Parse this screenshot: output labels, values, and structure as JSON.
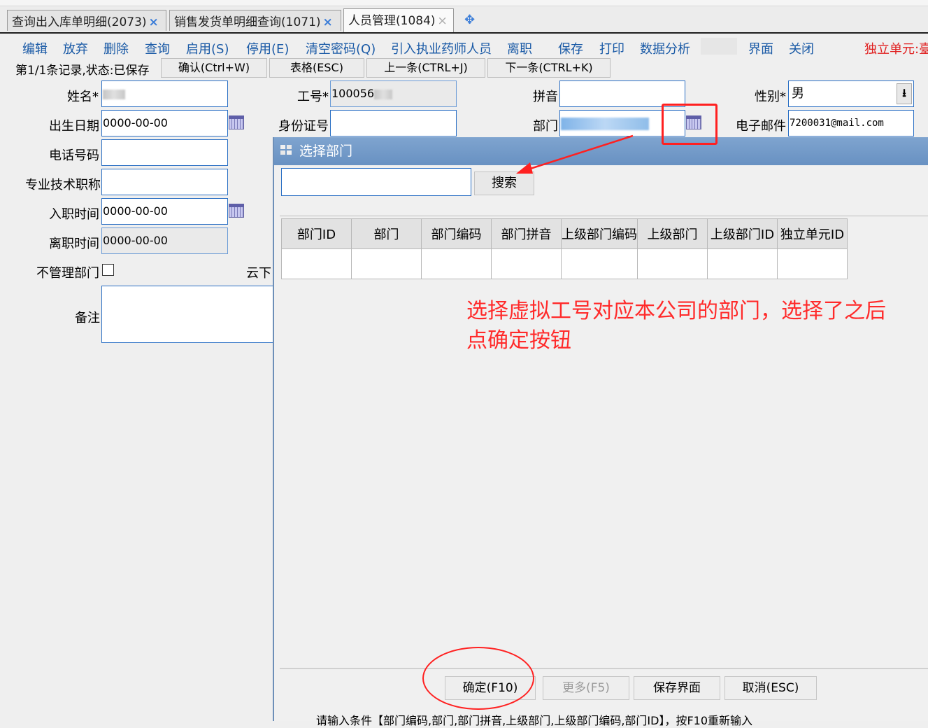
{
  "tabs": [
    {
      "label": "查询出入库单明细(2073)",
      "close": "×"
    },
    {
      "label": "销售发货单明细查询(1071)",
      "close": "×"
    },
    {
      "label": "人员管理(1084)",
      "close": "×"
    }
  ],
  "tab_add": "✥",
  "menu": [
    "编辑",
    "放弃",
    "删除",
    "查询",
    "启用(S)",
    "停用(E)",
    "清空密码(Q)",
    "引入执业药师人员",
    "离职",
    "保存",
    "打印",
    "数据分析",
    "界面",
    "关闭"
  ],
  "unit_label": "独立单元:臺",
  "record_status": "第1/1条记录,状态:已保存",
  "nav": {
    "confirm": "确认(Ctrl+W)",
    "grid": "表格(ESC)",
    "prev": "上一条(CTRL+J)",
    "next": "下一条(CTRL+K)"
  },
  "form": {
    "name_label": "姓名*",
    "name_value": "",
    "empno_label": "工号*",
    "empno_value": "100056",
    "pinyin_label": "拼音",
    "gender_label": "性别*",
    "gender_value": "男",
    "birth_label": "出生日期",
    "birth_value": "0000-00-00",
    "idcard_label": "身份证号",
    "dept_label": "部门",
    "email_label": "电子邮件",
    "email_value": "7200031@mail.com",
    "phone_label": "电话号码",
    "title_label": "专业技术职称",
    "join_label": "入职时间",
    "join_value": "0000-00-00",
    "leave_label": "离职时间",
    "leave_value": "0000-00-00",
    "nomanage_label": "不管理部门",
    "cloud_label": "云下",
    "remark_label": "备注"
  },
  "dialog": {
    "title": "选择部门",
    "search_button": "搜索",
    "columns": [
      "部门ID",
      "部门",
      "部门编码",
      "部门拼音",
      "上级部门编码",
      "上级部门",
      "上级部门ID",
      "独立单元ID"
    ],
    "note_line1": "选择虚拟工号对应本公司的部门，选择了之后",
    "note_line2": "点确定按钮",
    "buttons": {
      "ok": "确定(F10)",
      "more": "更多(F5)",
      "save_layout": "保存界面",
      "cancel": "取消(ESC)"
    },
    "hint": "请输入条件【部门编码,部门,部门拼音,上级部门,上级部门编码,部门ID】，按F10重新输入"
  },
  "colors": {
    "accent": "#1a5aa6",
    "annotation": "#ff2020",
    "dialog_title": "#6f97c6"
  }
}
